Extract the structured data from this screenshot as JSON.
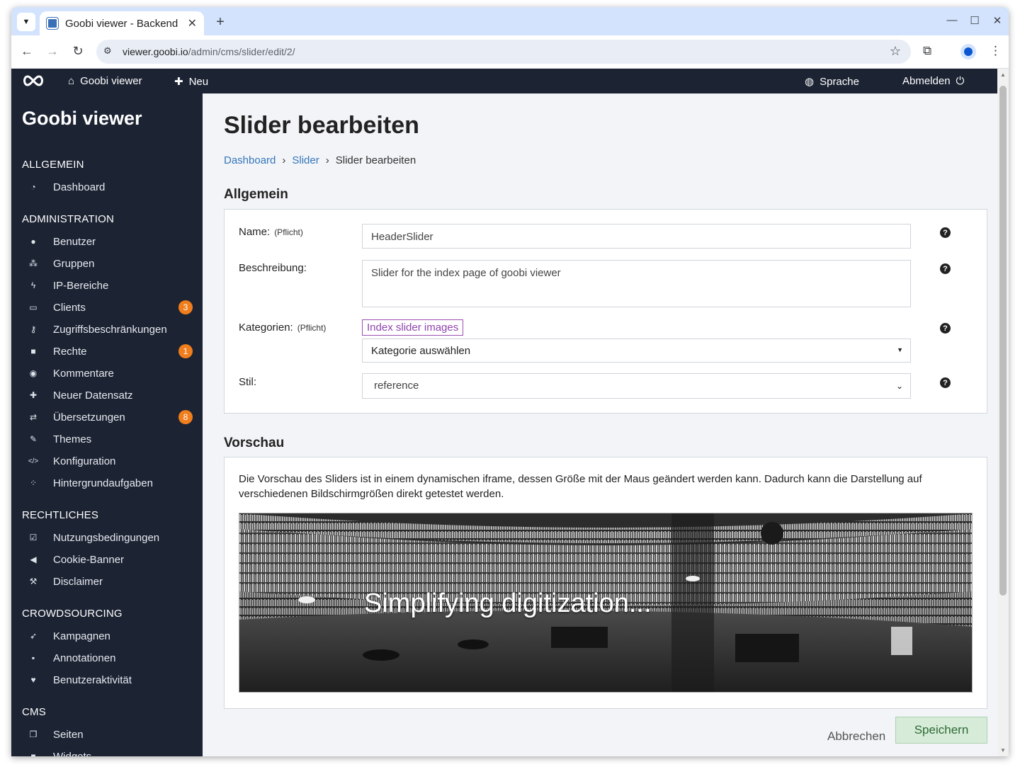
{
  "browser": {
    "tab_title": "Goobi viewer - Backend",
    "url_host": "viewer.goobi.io",
    "url_path": "/admin/cms/slider/edit/2/"
  },
  "appbar": {
    "home_label": "Goobi viewer",
    "new_label": "Neu",
    "language_label": "Sprache",
    "logout_label": "Abmelden"
  },
  "sidebar": {
    "brand": "Goobi viewer",
    "sections": {
      "general": "ALLGEMEIN",
      "admin": "ADMINISTRATION",
      "legal": "RECHTLICHES",
      "crowd": "CROWDSOURCING",
      "cms": "CMS"
    },
    "items": {
      "dashboard": "Dashboard",
      "users": "Benutzer",
      "groups": "Gruppen",
      "ip": "IP-Bereiche",
      "clients": "Clients",
      "access": "Zugriffsbeschränkungen",
      "rights": "Rechte",
      "comments": "Kommentare",
      "new_record": "Neuer Datensatz",
      "translations": "Übersetzungen",
      "themes": "Themes",
      "config": "Konfiguration",
      "tasks": "Hintergrundaufgaben",
      "terms": "Nutzungsbedingungen",
      "cookie": "Cookie-Banner",
      "disclaimer": "Disclaimer",
      "campaigns": "Kampagnen",
      "annotations": "Annotationen",
      "activity": "Benutzeraktivität",
      "pages": "Seiten",
      "widgets": "Widgets"
    },
    "badges": {
      "clients": "3",
      "rights": "1",
      "translations": "8"
    }
  },
  "page": {
    "title": "Slider bearbeiten",
    "breadcrumb": [
      "Dashboard",
      "Slider",
      "Slider bearbeiten"
    ],
    "breadcrumb_sep": "›",
    "general_title": "Allgemein",
    "preview_title": "Vorschau"
  },
  "form": {
    "name_label": "Name:",
    "required": "(Pflicht)",
    "name_value": "HeaderSlider",
    "desc_label": "Beschreibung:",
    "desc_value": "Slider for the index page of goobi viewer",
    "cat_label": "Kategorien:",
    "cat_chip": "Index slider images",
    "cat_select": "Kategorie auswählen",
    "style_label": "Stil:",
    "style_value": "reference"
  },
  "preview": {
    "text": "Die Vorschau des Sliders ist in einem dynamischen iframe, dessen Größe mit der Maus geändert werden kann. Dadurch kann die Darstellung auf verschiedenen Bildschirmgrößen direkt getestet werden.",
    "caption": "Simplifying digitization..."
  },
  "actions": {
    "cancel": "Abbrechen",
    "save": "Speichern"
  },
  "colors": {
    "sidebar_bg": "#1c2333",
    "badge": "#f07e1c",
    "link": "#3575bb",
    "chip": "#8e44ad",
    "save_bg": "#d7ebd9"
  }
}
